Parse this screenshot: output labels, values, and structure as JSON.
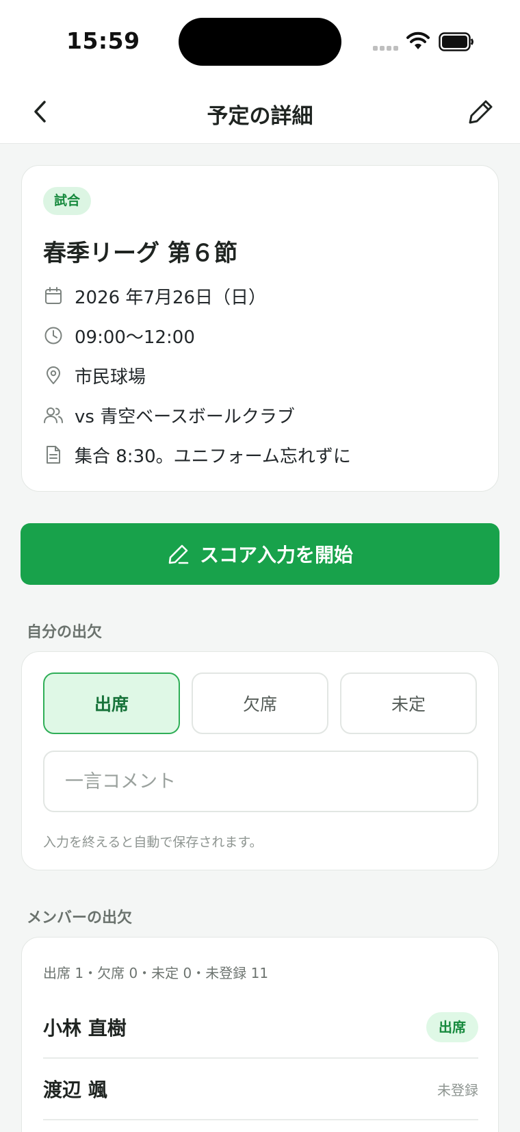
{
  "status_bar": {
    "time": "15:59"
  },
  "nav": {
    "title": "予定の詳細"
  },
  "event": {
    "tag": "試合",
    "title": "春季リーグ 第６節",
    "date": "2026 年7月26日（日）",
    "time": "09:00〜12:00",
    "location": "市民球場",
    "opponent": "vs 青空ベースボールクラブ",
    "note": "集合 8:30。ユニフォーム忘れずに"
  },
  "score_button": {
    "label": "スコア入力を開始"
  },
  "my_attendance": {
    "section_label": "自分の出欠",
    "options": [
      "出席",
      "欠席",
      "未定"
    ],
    "selected": "出席",
    "comment_placeholder": "一言コメント",
    "comment_value": "",
    "autosave_note": "入力を終えると自動で保存されます。"
  },
  "members": {
    "section_label": "メンバーの出欠",
    "summary": "出席 1・欠席 0・未定 0・未登録 11",
    "rows": [
      {
        "name": "小林 直樹",
        "status": "出席"
      },
      {
        "name": "渡辺 颯",
        "status": "未登録"
      }
    ]
  },
  "colors": {
    "primary": "#18a24b",
    "tag_bg": "#dcf5e3",
    "tag_text": "#178a3e",
    "selected_bg": "#dff8e6",
    "selected_border": "#2fae57"
  }
}
